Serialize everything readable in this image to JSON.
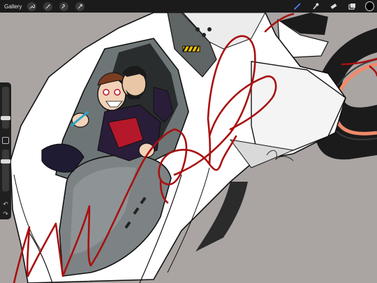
{
  "toolbar": {
    "gallery_label": "Gallery",
    "left_tools": [
      "wrench-icon",
      "magic-wand-icon",
      "selection-icon",
      "transform-arrow-icon"
    ],
    "right_tools": [
      "brush-icon",
      "smudge-icon",
      "eraser-icon",
      "layers-icon",
      "color-picker"
    ],
    "active_tool": "brush-icon",
    "current_color": "#000000"
  },
  "sidebar": {
    "brush_size": 0.22,
    "opacity": 0.75,
    "buttons": [
      "modify-button",
      "undo-icon",
      "redo-icon"
    ],
    "undo_glyph": "↶",
    "redo_glyph": "↷"
  },
  "canvas": {
    "description_colors": {
      "background": "#aaa5a3",
      "ship_body": "#ffffff",
      "stroke": "#a81010",
      "accent_ring": "#f08a6a"
    }
  }
}
